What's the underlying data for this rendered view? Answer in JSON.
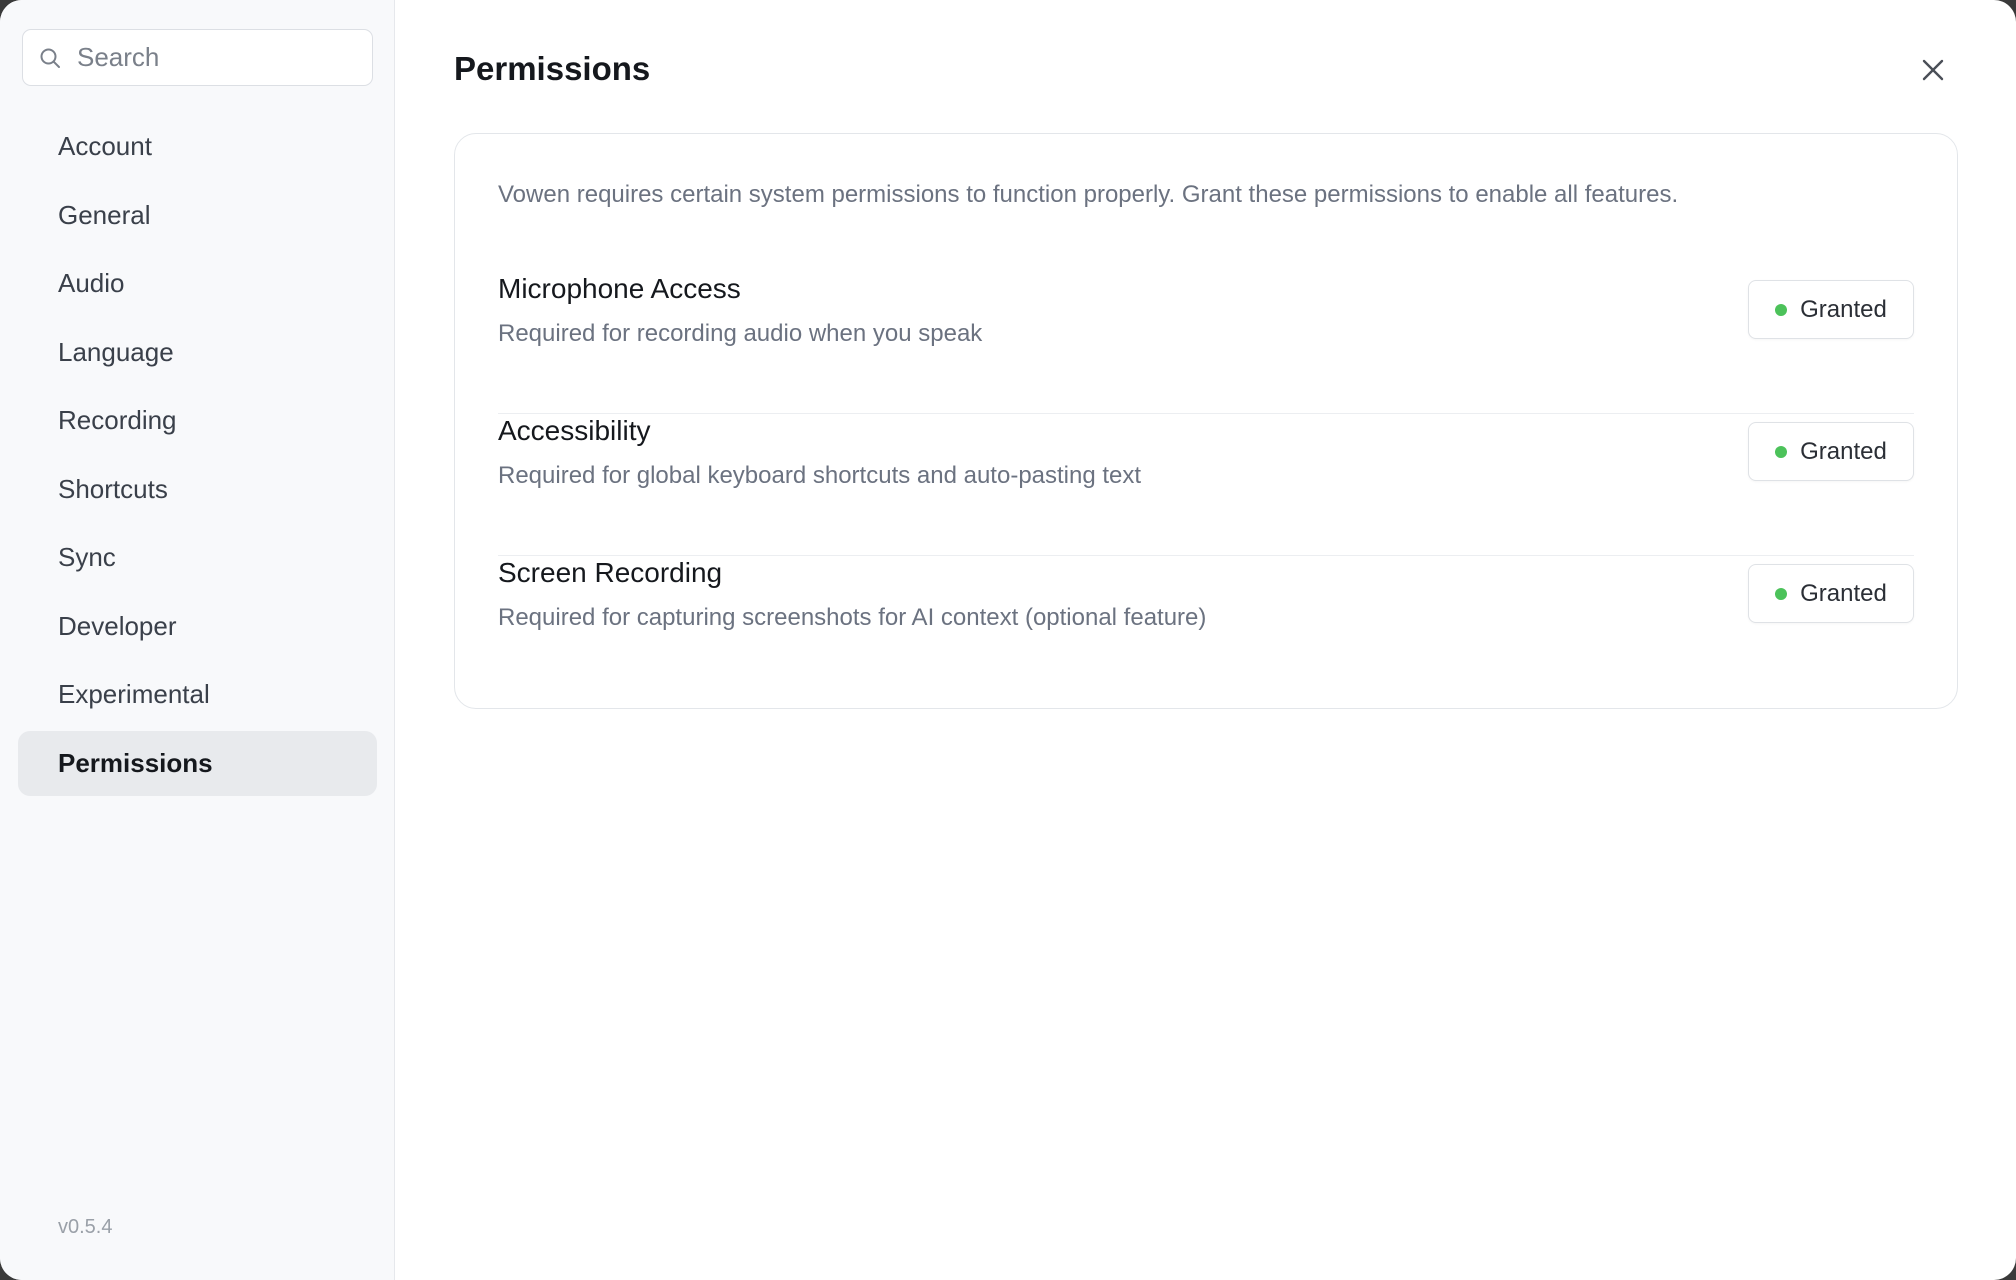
{
  "search": {
    "placeholder": "Search"
  },
  "sidebar": {
    "items": [
      {
        "label": "Account"
      },
      {
        "label": "General"
      },
      {
        "label": "Audio"
      },
      {
        "label": "Language"
      },
      {
        "label": "Recording"
      },
      {
        "label": "Shortcuts"
      },
      {
        "label": "Sync"
      },
      {
        "label": "Developer"
      },
      {
        "label": "Experimental"
      },
      {
        "label": "Permissions"
      }
    ],
    "active": "Permissions",
    "version": "v0.5.4"
  },
  "main": {
    "title": "Permissions",
    "intro": "Vowen requires certain system permissions to function properly. Grant these permissions to enable all features.",
    "permissions": [
      {
        "name": "Microphone Access",
        "description": "Required for recording audio when you speak",
        "status": "Granted"
      },
      {
        "name": "Accessibility",
        "description": "Required for global keyboard shortcuts and auto-pasting text",
        "status": "Granted"
      },
      {
        "name": "Screen Recording",
        "description": "Required for capturing screenshots for AI context (optional feature)",
        "status": "Granted"
      }
    ]
  },
  "colors": {
    "status_granted": "#4cc25a",
    "active_nav_bg": "#e8eaed"
  },
  "icons": {
    "search": "search-icon",
    "close": "close-icon"
  }
}
